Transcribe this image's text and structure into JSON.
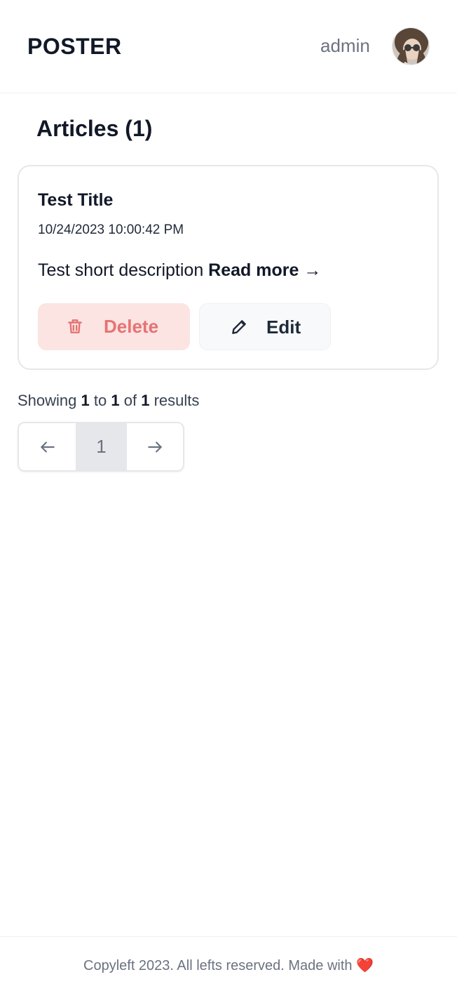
{
  "header": {
    "brand": "POSTER",
    "username": "admin"
  },
  "page": {
    "title": "Articles (1)"
  },
  "articles": [
    {
      "title": "Test Title",
      "date": "10/24/2023 10:00:42 PM",
      "description": "Test short description",
      "read_more": "Read more →",
      "delete_label": "Delete",
      "edit_label": "Edit"
    }
  ],
  "pagination": {
    "summary_prefix": "Showing",
    "from": "1",
    "to_word": "to",
    "to": "1",
    "of_word": "of",
    "total": "1",
    "suffix": "results",
    "current_page": "1",
    "prev_icon": "arrow-left-icon",
    "next_icon": "arrow-right-icon"
  },
  "footer": {
    "text": "Copyleft 2023. All lefts reserved. Made with",
    "heart": "❤️"
  },
  "colors": {
    "delete_bg": "#fbe4e2",
    "delete_fg": "#e57373",
    "page_active_bg": "#e5e7eb"
  }
}
